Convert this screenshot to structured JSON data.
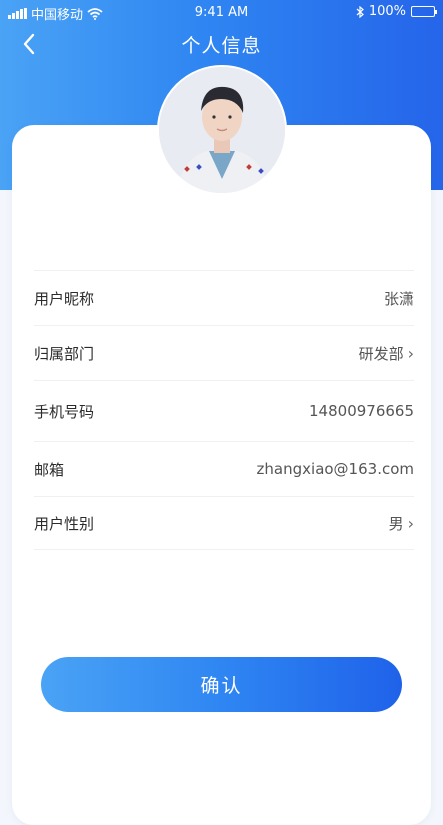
{
  "status_bar": {
    "carrier": "中国移动",
    "time": "9:41 AM",
    "battery": "100%",
    "battery_level": 1.0,
    "icons": [
      "signal-icon",
      "wifi-icon",
      "bluetooth-icon",
      "battery-icon"
    ]
  },
  "nav": {
    "title": "个人信息",
    "back_icon": "chevron-left-icon"
  },
  "profile": {
    "avatar_icon": "avatar-photo"
  },
  "fields": [
    {
      "label": "用户昵称",
      "value": "张潇",
      "has_chevron": false
    },
    {
      "label": "归属部门",
      "value": "研发部",
      "has_chevron": true
    },
    {
      "label": "手机号码",
      "value": "14800976665",
      "has_chevron": false
    },
    {
      "label": "邮箱",
      "value": "zhangxiao@163.com",
      "has_chevron": false
    },
    {
      "label": "用户性别",
      "value": "男",
      "has_chevron": true
    }
  ],
  "confirm_label": "确认",
  "colors": {
    "accent_start": "#4aa3f5",
    "accent_end": "#2565ea",
    "background": "#f3f6fc",
    "card": "#ffffff"
  }
}
